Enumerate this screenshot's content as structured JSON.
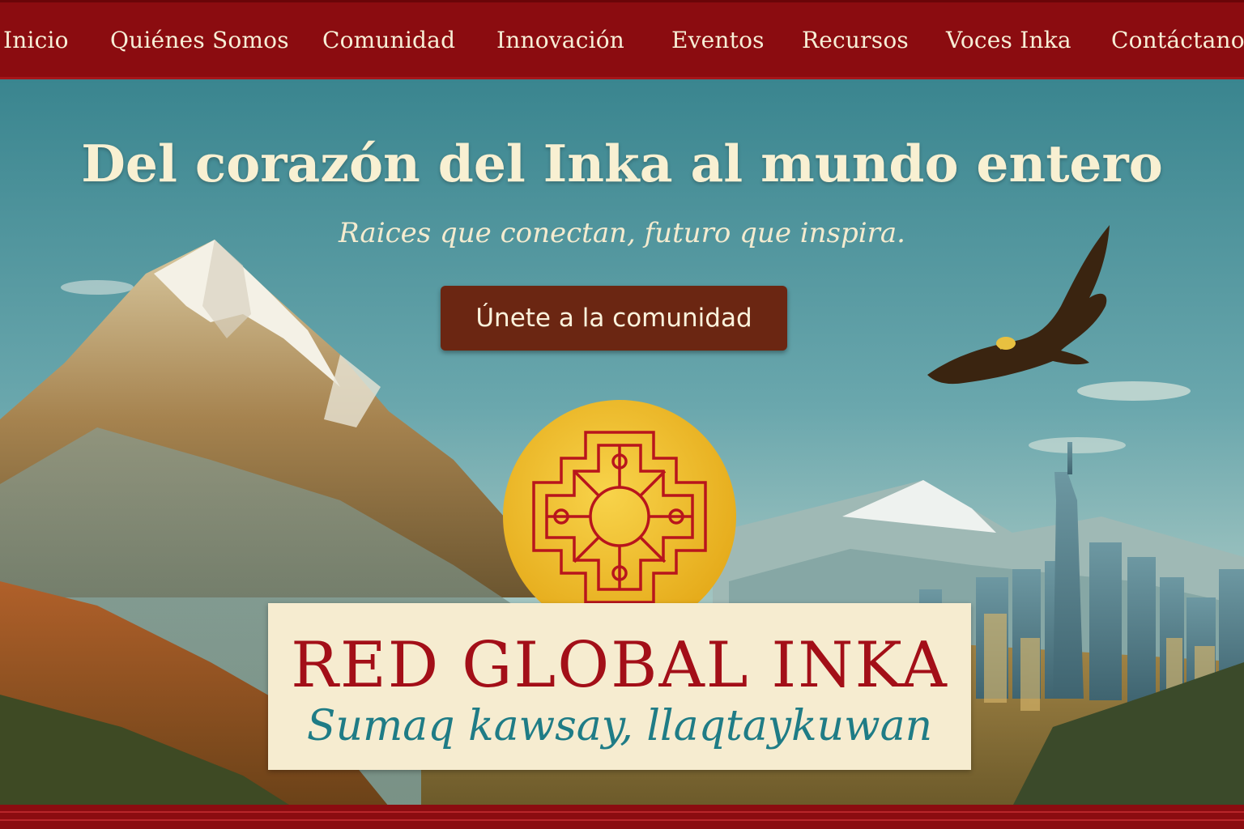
{
  "nav": {
    "items": [
      {
        "label": "Inicio"
      },
      {
        "label": "Quiénes Somos"
      },
      {
        "label": "Comunidad"
      },
      {
        "label": "Innovación"
      },
      {
        "label": "Eventos"
      },
      {
        "label": "Recursos"
      },
      {
        "label": "Voces Inka"
      },
      {
        "label": "Contáctanos"
      }
    ]
  },
  "hero": {
    "headline": "Del corazón del Inka al mundo entero",
    "tagline": "Raices que conectan, futuro que inspira.",
    "cta_label": "Únete a la comunidad"
  },
  "brand": {
    "title": "RED GLOBAL INKA",
    "subtitle": "Sumaq kawsay, llaqtaykuwan"
  },
  "colors": {
    "nav_bg": "#8b0c10",
    "cta_bg": "#6b2612",
    "brand_red": "#a30f18",
    "brand_teal": "#1f7c86",
    "logo_gold": "#f2c22a"
  },
  "icons": {
    "logo": "chakana-cross-icon",
    "bird": "condor-icon"
  }
}
